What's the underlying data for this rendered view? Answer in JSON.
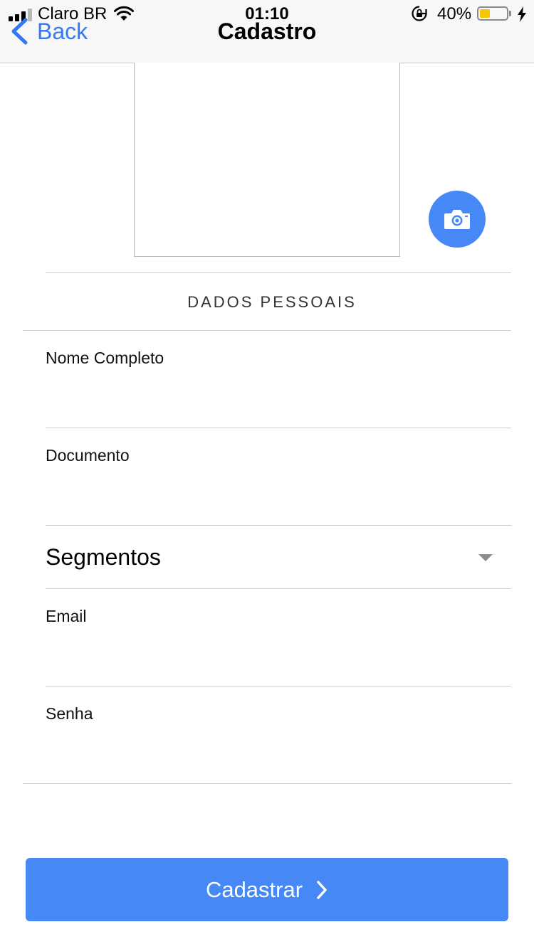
{
  "status_bar": {
    "carrier": "Claro BR",
    "time": "01:10",
    "battery_percent": "40%",
    "battery_level": 0.4,
    "battery_color": "#f6c700"
  },
  "nav": {
    "back_label": "Back",
    "title": "Cadastro"
  },
  "photo": {
    "camera_icon": "camera-icon",
    "accent": "#4788f7"
  },
  "section": {
    "title": "DADOS PESSOAIS"
  },
  "form": {
    "full_name_label": "Nome Completo",
    "full_name_value": "",
    "document_label": "Documento",
    "document_value": "",
    "segments_value": "Segmentos",
    "email_label": "Email",
    "email_value": "",
    "password_label": "Senha",
    "password_value": ""
  },
  "actions": {
    "submit_label": "Cadastrar",
    "submit_color": "#4788f7"
  }
}
